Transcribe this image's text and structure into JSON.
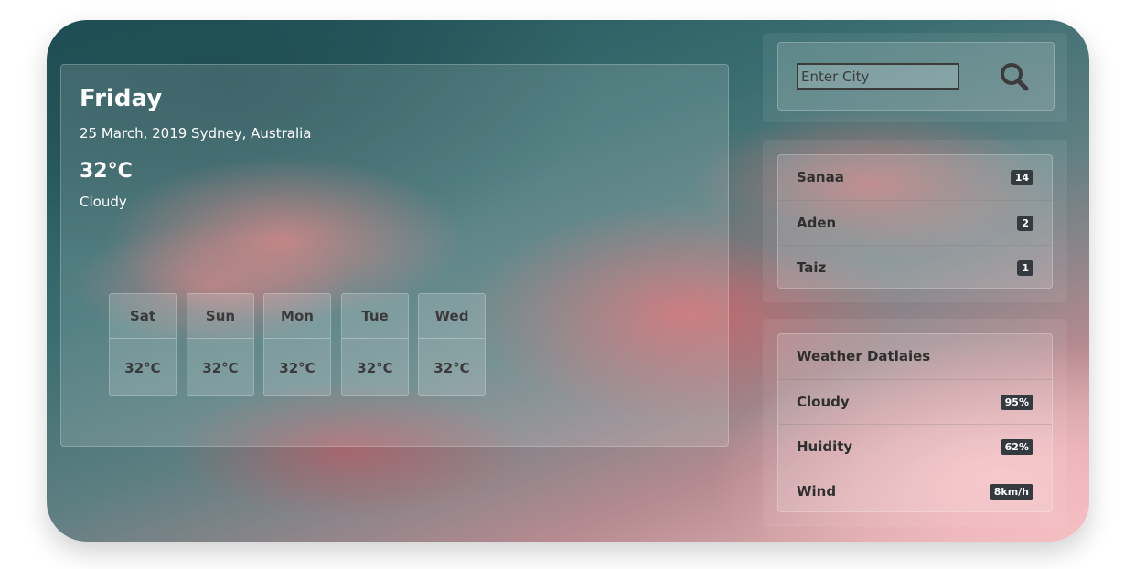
{
  "current": {
    "day": "Friday",
    "date_location": "25 March, 2019 Sydney, Australia",
    "temperature": "32°C",
    "condition": "Cloudy"
  },
  "forecast": [
    {
      "day": "Sat",
      "temp": "32°C"
    },
    {
      "day": "Sun",
      "temp": "32°C"
    },
    {
      "day": "Mon",
      "temp": "32°C"
    },
    {
      "day": "Tue",
      "temp": "32°C"
    },
    {
      "day": "Wed",
      "temp": "32°C"
    }
  ],
  "search": {
    "placeholder": "Enter City",
    "icon": "search-icon"
  },
  "cities": [
    {
      "name": "Sanaa",
      "count": "14"
    },
    {
      "name": "Aden",
      "count": "2"
    },
    {
      "name": "Taiz",
      "count": "1"
    }
  ],
  "details": {
    "title": "Weather Datlaies",
    "items": [
      {
        "label": "Cloudy",
        "value": "95%"
      },
      {
        "label": "Huidity",
        "value": "62%"
      },
      {
        "label": "Wind",
        "value": "8km/h"
      }
    ]
  },
  "colors": {
    "badge": "#343a40",
    "text_dark": "#2f2f2f",
    "text_light": "#ffffff"
  }
}
